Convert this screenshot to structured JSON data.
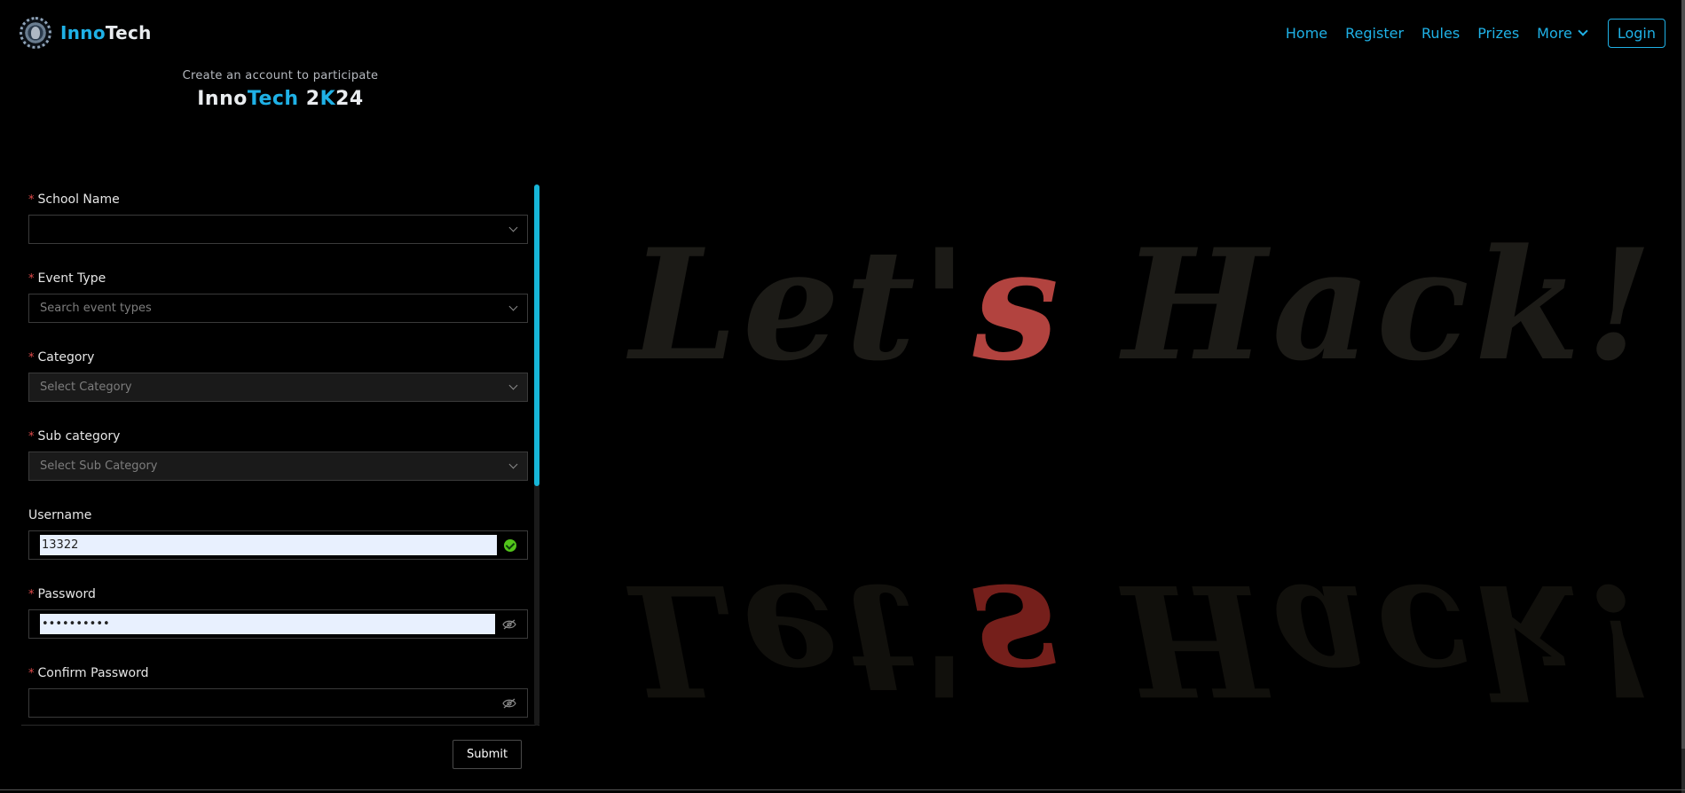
{
  "nav": {
    "brand": {
      "inno": "Inno",
      "tech": "Tech"
    },
    "links": [
      "Home",
      "Register",
      "Rules",
      "Prizes",
      "More"
    ],
    "login": "Login"
  },
  "header": {
    "subtitle": "Create an account to participate",
    "title_parts": [
      "Inno",
      "Tech",
      "2",
      "K",
      "24"
    ]
  },
  "form": {
    "fields": [
      {
        "label": "School Name",
        "required": true,
        "placeholder": "",
        "kind": "select"
      },
      {
        "label": "Event Type",
        "required": true,
        "placeholder": "Search event types",
        "kind": "select"
      },
      {
        "label": "Category",
        "required": true,
        "placeholder": "Select Category",
        "kind": "select"
      },
      {
        "label": "Sub category",
        "required": true,
        "placeholder": "Select Sub Category",
        "kind": "select"
      },
      {
        "label": "Username",
        "required": false,
        "value": "13322",
        "kind": "input"
      },
      {
        "label": "Password",
        "required": true,
        "value": "••••••••••",
        "kind": "password"
      },
      {
        "label": "Confirm Password",
        "required": true,
        "value": "",
        "kind": "password"
      }
    ],
    "required_mark": "*",
    "submit": "Submit"
  },
  "hero": {
    "text": "Let's Hack!"
  },
  "colors": {
    "accent": "#1fb1e6",
    "required": "#e24c4c",
    "success": "#52c41a",
    "scroll": "#17b6d8"
  }
}
